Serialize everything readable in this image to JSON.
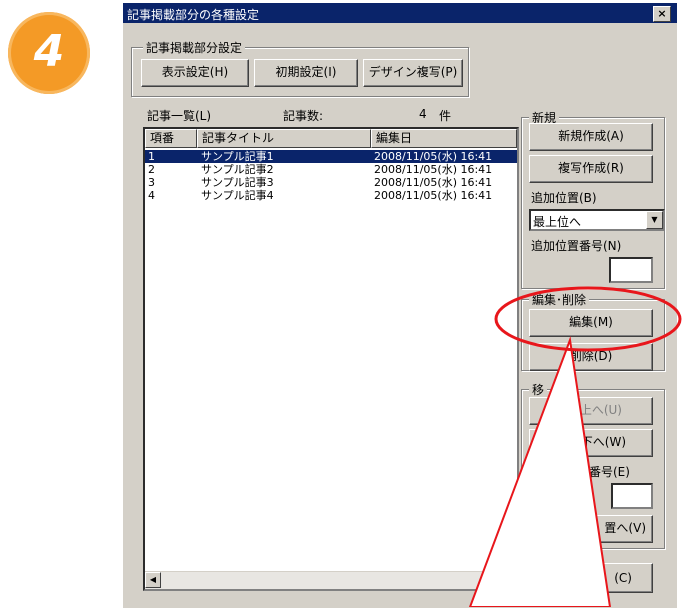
{
  "step_badge": "4",
  "dialog": {
    "title": "記事掲載部分の各種設定",
    "close": "×"
  },
  "settings_group": {
    "label": "記事掲載部分設定",
    "buttons": [
      "表示設定(H)",
      "初期設定(I)",
      "デザイン複写(P)"
    ]
  },
  "list": {
    "label": "記事一覧(L)",
    "count_label": "記事数:",
    "count": "4",
    "count_unit": "件",
    "columns": [
      "項番",
      "記事タイトル",
      "編集日"
    ],
    "rows": [
      {
        "no": "1",
        "title": "サンプル記事1",
        "date": "2008/11/05(水) 16:41"
      },
      {
        "no": "2",
        "title": "サンプル記事2",
        "date": "2008/11/05(水) 16:41"
      },
      {
        "no": "3",
        "title": "サンプル記事3",
        "date": "2008/11/05(水) 16:41"
      },
      {
        "no": "4",
        "title": "サンプル記事4",
        "date": "2008/11/05(水) 16:41"
      }
    ],
    "scroll_left": "◀"
  },
  "new_group": {
    "label": "新規",
    "create": "新規作成(A)",
    "copy": "複写作成(R)",
    "position_label": "追加位置(B)",
    "position_value": "最上位へ",
    "position_number_label": "追加位置番号(N)"
  },
  "edit_group": {
    "label": "編集･削除",
    "edit": "編集(M)",
    "delete": "削除(D)"
  },
  "move_group": {
    "label": "移",
    "up": "上へ(U)",
    "down": "下へ(W)",
    "number_label": "番号(E)",
    "move_to": "置へ(V)"
  },
  "close_button": "(C)",
  "annotation_color": "#e8161b"
}
